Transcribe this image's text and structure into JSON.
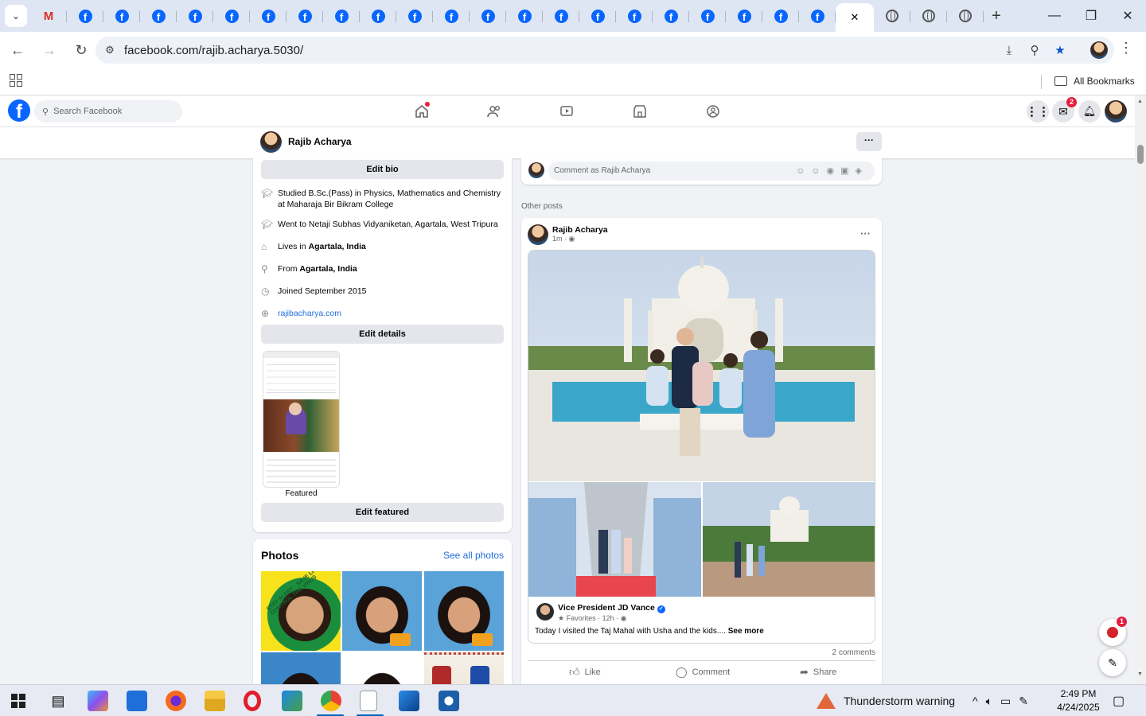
{
  "browser": {
    "tabs": {
      "count_facebook": 21,
      "active_close": "✕",
      "new_tab": "+"
    },
    "address": "facebook.com/rajib.acharya.5030/",
    "bookmarks_label": "All Bookmarks",
    "window": {
      "minimize": "—",
      "restore": "❐",
      "close": "✕"
    }
  },
  "fb": {
    "search_placeholder": "Search Facebook",
    "messenger_badge": "2",
    "profile_name": "Rajib Acharya",
    "more": "···"
  },
  "intro": {
    "edit_bio": "Edit bio",
    "rows": [
      {
        "icon": "graduation-cap-icon",
        "text": "Studied B.Sc.(Pass) in Physics, Mathematics and Chemistry at Maharaja Bir Bikram College"
      },
      {
        "icon": "graduation-cap-icon",
        "text": "Went to Netaji Subhas Vidyaniketan, Agartala, West Tripura"
      },
      {
        "icon": "home-icon",
        "prefix": "Lives in ",
        "bold": "Agartala, India"
      },
      {
        "icon": "location-pin-icon",
        "prefix": "From ",
        "bold": "Agartala, India"
      },
      {
        "icon": "clock-icon",
        "text": "Joined September 2015"
      },
      {
        "icon": "globe-icon",
        "link": "rajibacharya.com"
      }
    ],
    "edit_details": "Edit details",
    "featured_label": "Featured",
    "edit_featured": "Edit featured"
  },
  "photos": {
    "title": "Photos",
    "see_all": "See all photos",
    "tile1_text": "STAY ALERT · SAVE LIVES · CONTROL THE VIRUS"
  },
  "comment": {
    "placeholder": "Comment as Rajib Acharya"
  },
  "other_posts_label": "Other posts",
  "post": {
    "author": "Rajib Acharya",
    "meta": "1m ·",
    "more": "···",
    "shared_author": "Vice President JD Vance",
    "shared_meta": "Favorites · 12h ·",
    "shared_text": "Today I visited the Taj Mahal with Usha and the kids....",
    "see_more": "See more",
    "comments_count": "2 comments",
    "actions": {
      "like": "Like",
      "comment": "Comment",
      "share": "Share"
    }
  },
  "float": {
    "badge": "1"
  },
  "taskbar": {
    "weather": "Thunderstorm warning",
    "time": "2:49 PM",
    "date": "4/24/2025"
  }
}
